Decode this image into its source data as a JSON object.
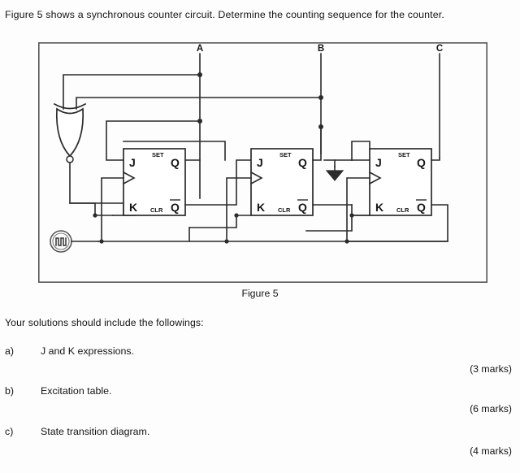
{
  "question": {
    "text": "Figure 5 shows a synchronous counter circuit.  Determine the counting sequence for the counter."
  },
  "figure": {
    "caption": "Figure 5",
    "signal_labels": [
      "A",
      "B",
      "C"
    ],
    "flipflops": [
      {
        "name": "flip-flop-1",
        "j": "J",
        "k": "K",
        "set": "SET",
        "clr": "CLR",
        "q": "Q",
        "qbar": "Q"
      },
      {
        "name": "flip-flop-2",
        "j": "J",
        "k": "K",
        "set": "SET",
        "clr": "CLR",
        "q": "Q",
        "qbar": "Q"
      },
      {
        "name": "flip-flop-3",
        "j": "J",
        "k": "K",
        "set": "SET",
        "clr": "CLR",
        "q": "Q",
        "qbar": "Q"
      }
    ],
    "gate": "xnor-gate",
    "clock_source": "clock-source",
    "ground": "ground-symbol"
  },
  "solutions": {
    "intro": "Your solutions should include the followings:",
    "items": [
      {
        "label": "a)",
        "text": "J and K expressions.",
        "marks": "(3 marks)"
      },
      {
        "label": "b)",
        "text": "Excitation table.",
        "marks": "(6 marks)"
      },
      {
        "label": "c)",
        "text": "State transition diagram.",
        "marks": "(4 marks)"
      }
    ]
  },
  "colors": {
    "ink": "#151515",
    "line": "#2b2b2b",
    "paper": "#fdfdfd"
  }
}
